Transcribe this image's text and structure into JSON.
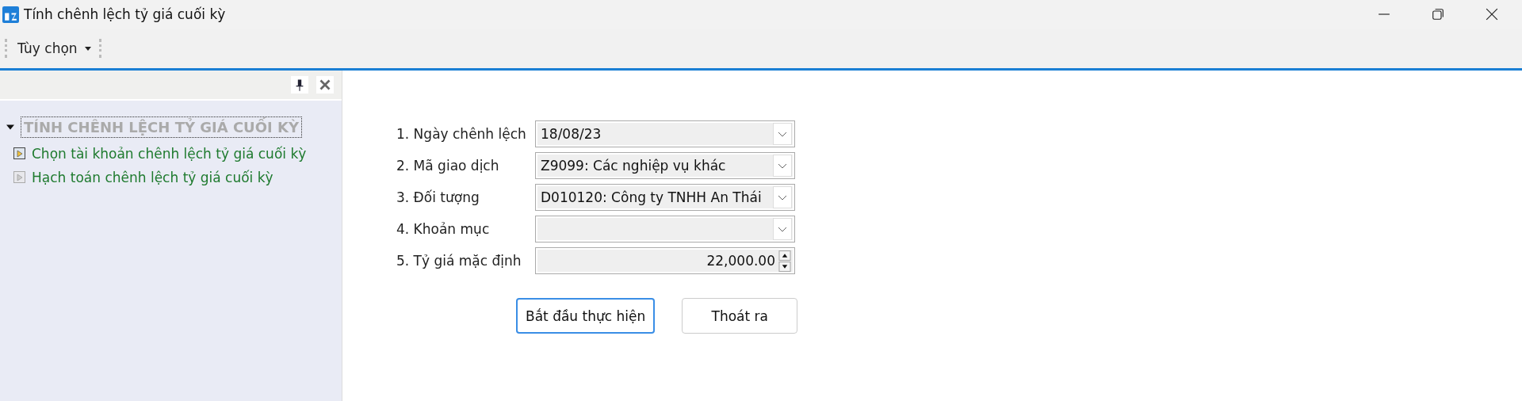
{
  "window": {
    "title": "Tính chênh lệch tỷ giá cuối kỳ"
  },
  "toolbar": {
    "menu": "Tùy chọn"
  },
  "tree": {
    "label": "TÍNH CHÊNH LỆCH TỶ GIÁ CUỐI KỲ",
    "expanded": true,
    "selected": true,
    "children": [
      {
        "label": "Chọn tài khoản chênh lệch tỷ giá cuối kỳ",
        "disabled": false
      },
      {
        "label": "Hạch toán chênh lệch tỷ giá cuối kỳ",
        "disabled": true
      }
    ]
  },
  "form": {
    "fields": [
      {
        "label": "1. Ngày chênh lệch",
        "kind": "dropdown",
        "value": "18/08/23"
      },
      {
        "label": "2. Mã giao dịch",
        "kind": "dropdown",
        "value": "Z9099: Các nghiệp vụ khác"
      },
      {
        "label": "3. Đối tượng",
        "kind": "dropdown",
        "value": "D010120: Công ty TNHH An Thái"
      },
      {
        "label": "4. Khoản mục",
        "kind": "dropdown"
      },
      {
        "label": "5. Tỷ giá mặc định",
        "kind": "spinner",
        "value": "22,000.00"
      }
    ]
  },
  "buttons": [
    {
      "label": "Bắt đầu thực hiện",
      "focused": true
    },
    {
      "label": "Thoát ra",
      "focused": false
    }
  ]
}
